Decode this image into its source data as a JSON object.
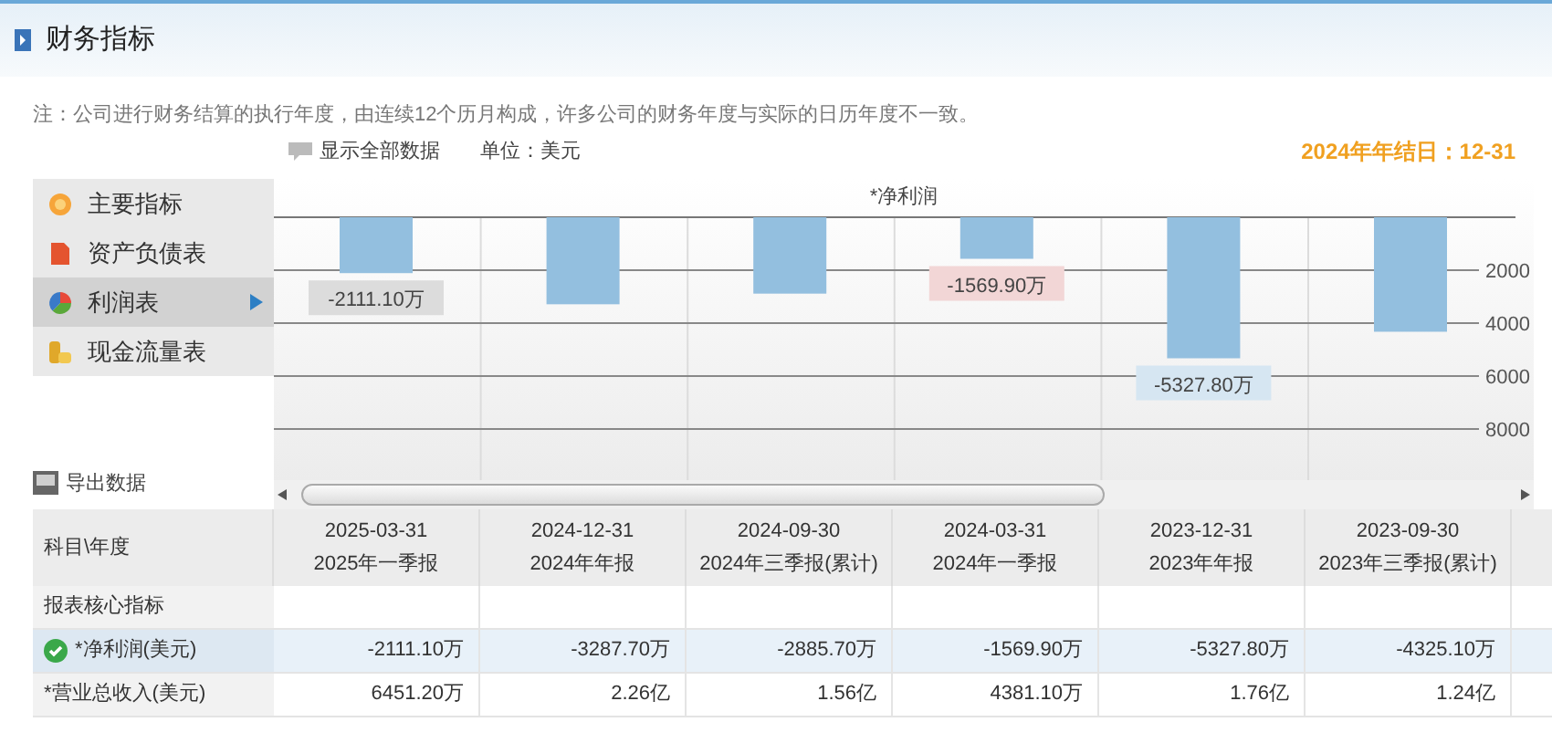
{
  "header": {
    "title": "财务指标"
  },
  "note": "注：公司进行财务结算的执行年度，由连续12个历月构成，许多公司的财务年度与实际的日历年度不一致。",
  "toolbar": {
    "show_all": "显示全部数据",
    "unit": "单位：美元",
    "year_end": "2024年年结日：12-31"
  },
  "menu": [
    {
      "label": "主要指标",
      "selected": false
    },
    {
      "label": "资产负债表",
      "selected": false
    },
    {
      "label": "利润表",
      "selected": true
    },
    {
      "label": "现金流量表",
      "selected": false
    }
  ],
  "export": "导出数据",
  "chart": {
    "chart_data": {
      "type": "bar",
      "title": "*净利润",
      "grid": true,
      "values": [
        -2111.1,
        -3287.7,
        -2885.7,
        -1569.9,
        -5327.8,
        -4325.1
      ],
      "ylim": [
        -10000,
        0
      ],
      "yticks": [
        {
          "value": -2000,
          "label": "2000"
        },
        {
          "value": -4000,
          "label": "4000"
        },
        {
          "value": -6000,
          "label": "6000"
        },
        {
          "value": -8000,
          "label": "8000"
        }
      ],
      "value_labels": [
        "-2111.10万",
        null,
        null,
        "-1569.90万",
        "-5327.80万",
        null
      ]
    }
  },
  "table": {
    "corner": "科目\\年度",
    "columns": [
      {
        "date": "2025-03-31",
        "report": "2025年一季报"
      },
      {
        "date": "2024-12-31",
        "report": "2024年年报"
      },
      {
        "date": "2024-09-30",
        "report": "2024年三季报(累计)"
      },
      {
        "date": "2024-03-31",
        "report": "2024年一季报"
      },
      {
        "date": "2023-12-31",
        "report": "2023年年报"
      },
      {
        "date": "2023-09-30",
        "report": "2023年三季报(累计)"
      }
    ],
    "rows": [
      {
        "kind": "section",
        "label": "报表核心指标",
        "selected": false
      },
      {
        "kind": "data",
        "label": "*净利润(美元)",
        "selected": true,
        "values": [
          "-2111.10万",
          "-3287.70万",
          "-2885.70万",
          "-1569.90万",
          "-5327.80万",
          "-4325.10万"
        ]
      },
      {
        "kind": "data",
        "label": "*营业总收入(美元)",
        "selected": false,
        "values": [
          "6451.20万",
          "2.26亿",
          "1.56亿",
          "4381.10万",
          "1.76亿",
          "1.24亿"
        ]
      }
    ]
  }
}
